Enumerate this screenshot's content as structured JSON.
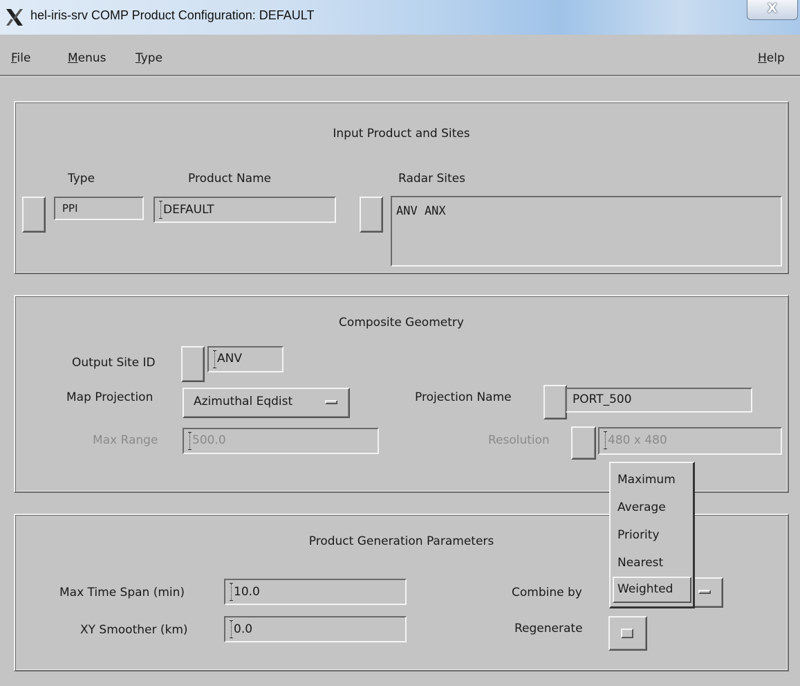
{
  "window": {
    "title": "hel-iris-srv  COMP  Product Configuration: DEFAULT",
    "close_label": "X"
  },
  "menubar": {
    "file": {
      "mnemonic": "F",
      "rest": "ile"
    },
    "menus": {
      "mnemonic": "M",
      "rest": "enus"
    },
    "type": {
      "mnemonic": "T",
      "rest": "ype"
    },
    "help": {
      "mnemonic": "H",
      "rest": "elp"
    }
  },
  "input_panel": {
    "title": "Input Product and Sites",
    "type_label": "Type",
    "type_value": "PPI",
    "product_name_label": "Product Name",
    "product_name_value": "DEFAULT",
    "radar_sites_label": "Radar Sites",
    "radar_sites_value": "ANV ANX"
  },
  "geometry_panel": {
    "title": "Composite Geometry",
    "output_site_label": "Output Site ID",
    "output_site_value": "ANV",
    "map_projection_label": "Map Projection",
    "map_projection_value": "Azimuthal Eqdist",
    "projection_name_label": "Projection Name",
    "projection_name_value": "PORT_500",
    "max_range_label": "Max Range",
    "max_range_value": "500.0",
    "resolution_label": "Resolution",
    "resolution_value": "480 x 480"
  },
  "generation_panel": {
    "title": "Product Generation Parameters",
    "max_time_span_label": "Max Time Span (min)",
    "max_time_span_value": "10.0",
    "xy_smoother_label": "XY Smoother (km)",
    "xy_smoother_value": "0.0",
    "combine_by_label": "Combine by",
    "regenerate_label": "Regenerate"
  },
  "combine_popup": {
    "options": [
      "Maximum",
      "Average",
      "Priority",
      "Nearest",
      "Weighted"
    ],
    "selected": "Weighted"
  }
}
